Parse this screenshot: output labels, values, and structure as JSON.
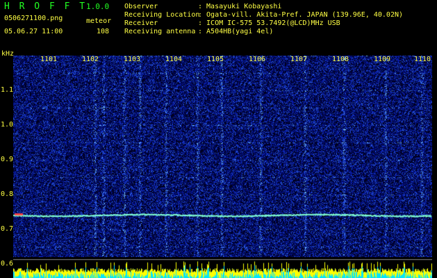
{
  "header": {
    "title": "H R O F F T",
    "version": "1.0.0",
    "filename": "0506271100.png",
    "mode": "meteor",
    "datetime": "05.06.27 11:00",
    "count": "108"
  },
  "info": [
    {
      "label": "Observer",
      "value": ": Masayuki Kobayashi"
    },
    {
      "label": "Receiving Location",
      "value": ": Ogata-vill. Akita-Pref. JAPAN (139.96E, 40.02N)"
    },
    {
      "label": "Receiver",
      "value": ": ICOM IC-575 53.7492(@LCD)MHz USB"
    },
    {
      "label": "Receiving antenna",
      "value": ": A504HB(yagi 4el)"
    }
  ],
  "axes": {
    "y_unit": "kHz",
    "y_ticks": [
      "1.1",
      "1.0",
      "0.9",
      "0.8",
      "0.7",
      "0.6"
    ],
    "x_ticks": [
      "1101",
      "1102",
      "1103",
      "1104",
      "1105",
      "1106",
      "1107",
      "1108",
      "1109",
      "1110"
    ]
  },
  "colors": {
    "label": "#ffff44",
    "title": "#22ff22",
    "background": "#000000",
    "trace": "#7fffd4"
  }
}
